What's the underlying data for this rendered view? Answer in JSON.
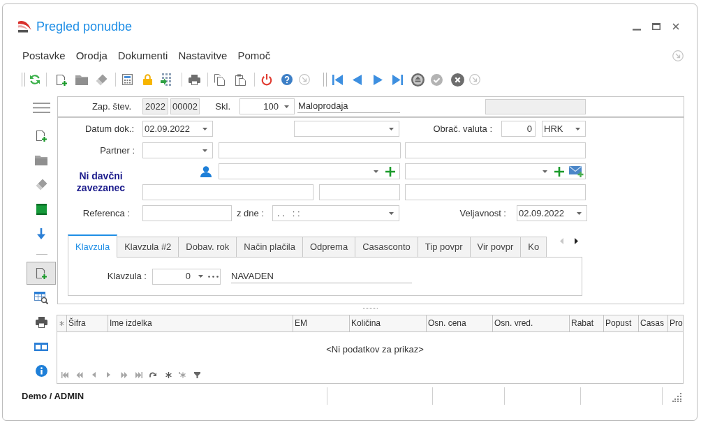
{
  "window": {
    "title": "Pregled ponudbe"
  },
  "menu": [
    {
      "label": "Postavke"
    },
    {
      "label": "Orodja"
    },
    {
      "label": "Dokumenti"
    },
    {
      "label": "Nastavitve"
    },
    {
      "label": "Pomoč"
    }
  ],
  "sidebar": {
    "items": [
      {
        "selected": false
      },
      {
        "selected": false
      },
      {
        "selected": false
      },
      {
        "selected": false
      },
      {
        "selected": false
      },
      {
        "selected": true
      },
      {
        "selected": false
      },
      {
        "selected": false
      },
      {
        "selected": false
      },
      {
        "selected": false
      }
    ]
  },
  "header": {
    "number_label": "Zap. štev.",
    "year": "2022",
    "number": "00002",
    "warehouse_label": "Skl.",
    "warehouse": "100",
    "warehouse_name": "Maloprodaja"
  },
  "form": {
    "date_label": "Datum dok.:",
    "date": "02.09.2022",
    "currency_label": "Obrač. valuta :",
    "exchange_rate": "0",
    "currency": "HRK",
    "partner_label": "Partner :",
    "tax_status": "Ni davčni zavezanec",
    "reference_label": "Referenca :",
    "from_label": "z dne :",
    "from_placeholder": ". .   : :",
    "validity_label": "Veljavnost :",
    "validity": "02.09.2022"
  },
  "tabs": [
    {
      "label": "Klavzula",
      "selected": true
    },
    {
      "label": "Klavzula #2",
      "selected": false
    },
    {
      "label": "Dobav. rok",
      "selected": false
    },
    {
      "label": "Način plačila",
      "selected": false
    },
    {
      "label": "Odprema",
      "selected": false
    },
    {
      "label": "Casasconto",
      "selected": false
    },
    {
      "label": "Tip povpr",
      "selected": false
    },
    {
      "label": "Vir povpr",
      "selected": false
    },
    {
      "label": "Ko",
      "selected": false
    }
  ],
  "clause": {
    "label": "Klavzula :",
    "code": "0",
    "name": "NAVADEN"
  },
  "grid": {
    "columns": [
      "Šifra",
      "Ime izdelka",
      "EM",
      "Količina",
      "Osn. cena",
      "Osn. vred.",
      "Rabat",
      "Popust",
      "Casas",
      "Pro"
    ],
    "empty_text": "<Ni podatkov za prikaz>"
  },
  "status_bar": {
    "user": "Demo / ADMIN"
  }
}
